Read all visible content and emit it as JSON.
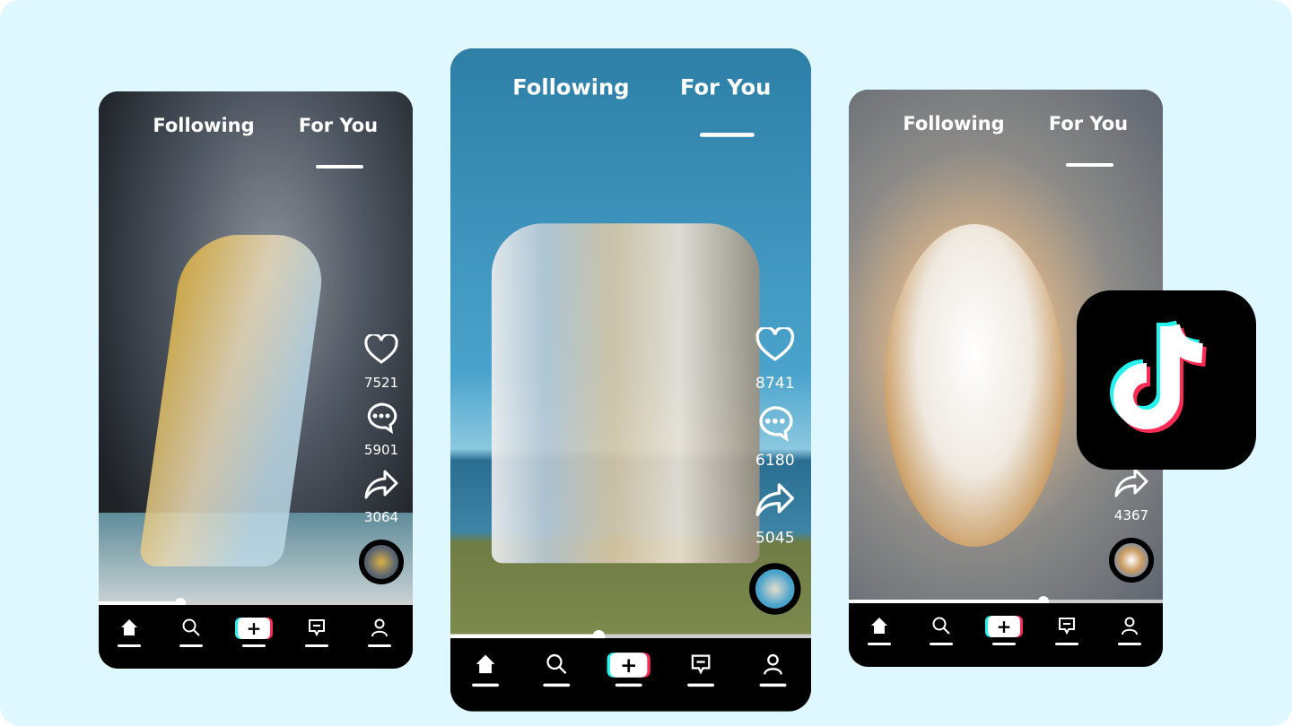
{
  "colors": {
    "background": "#dff7fe",
    "cyan": "#25f4ee",
    "pink": "#fe2c55",
    "bar": "#000000"
  },
  "logo": {
    "name": "TikTok",
    "icon": "tiktok-note-icon"
  },
  "phones": [
    {
      "tabs": [
        "Following",
        "For You"
      ],
      "active_tab": 1,
      "progress": 0.26,
      "actions": [
        {
          "icon": "heart-icon",
          "count": "7521"
        },
        {
          "icon": "comment-icon",
          "count": "5901"
        },
        {
          "icon": "share-icon",
          "count": "3064"
        }
      ],
      "nav": [
        "home-icon",
        "search-icon",
        "create-icon",
        "inbox-icon",
        "profile-icon"
      ]
    },
    {
      "tabs": [
        "Following",
        "For You"
      ],
      "active_tab": 1,
      "progress": 0.41,
      "actions": [
        {
          "icon": "heart-icon",
          "count": "8741"
        },
        {
          "icon": "comment-icon",
          "count": "6180"
        },
        {
          "icon": "share-icon",
          "count": "5045"
        }
      ],
      "nav": [
        "home-icon",
        "search-icon",
        "create-icon",
        "inbox-icon",
        "profile-icon"
      ]
    },
    {
      "tabs": [
        "Following",
        "For You"
      ],
      "active_tab": 1,
      "progress": 0.62,
      "actions": [
        {
          "icon": "share-icon",
          "count": "4367"
        }
      ],
      "nav": [
        "home-icon",
        "search-icon",
        "create-icon",
        "inbox-icon",
        "profile-icon"
      ]
    }
  ],
  "nav_plus": "+"
}
